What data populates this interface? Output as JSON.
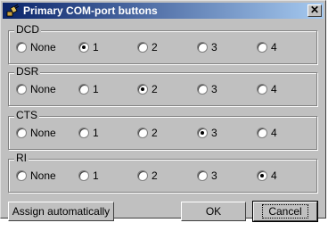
{
  "window": {
    "title": "Primary COM-port buttons",
    "close_label": "✕"
  },
  "groups": [
    {
      "label": "DCD",
      "options": [
        "None",
        "1",
        "2",
        "3",
        "4"
      ],
      "selected": "1"
    },
    {
      "label": "DSR",
      "options": [
        "None",
        "1",
        "2",
        "3",
        "4"
      ],
      "selected": "2"
    },
    {
      "label": "CTS",
      "options": [
        "None",
        "1",
        "2",
        "3",
        "4"
      ],
      "selected": "3"
    },
    {
      "label": "RI",
      "options": [
        "None",
        "1",
        "2",
        "3",
        "4"
      ],
      "selected": "4"
    }
  ],
  "buttons": {
    "assign": "Assign automatically",
    "ok": "OK",
    "cancel": "Cancel"
  },
  "colors": {
    "titlebar_start": "#0a246a",
    "titlebar_end": "#a6caf0",
    "face": "#c0c0c0"
  },
  "icons": {
    "title": "plug-connector-icon",
    "close": "close-icon"
  }
}
